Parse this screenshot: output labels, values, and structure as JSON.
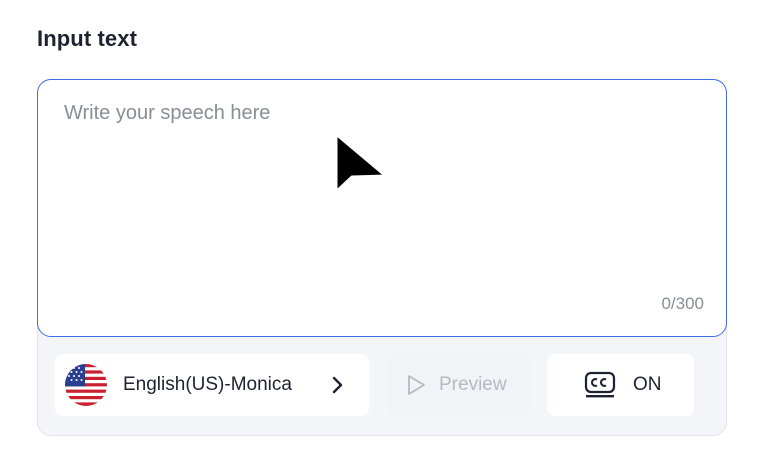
{
  "section": {
    "title": "Input text"
  },
  "editor": {
    "placeholder": "Write your speech here",
    "value": "",
    "char_count": "0/300",
    "accent_color": "#3f6fe6"
  },
  "voice": {
    "label": "English(US)-Monica",
    "flag_icon": "us-flag-icon",
    "chevron_icon": "chevron-right-icon"
  },
  "preview": {
    "label": "Preview",
    "icon": "play-icon",
    "disabled": true
  },
  "captions": {
    "label": "ON",
    "icon": "closed-captions-icon"
  }
}
